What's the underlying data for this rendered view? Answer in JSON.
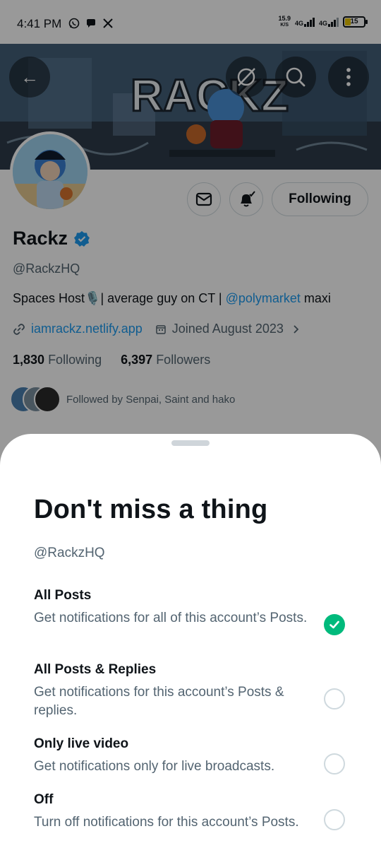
{
  "status_bar": {
    "time": "4:41 PM",
    "app_icons": [
      "whatsapp-icon",
      "chat-bubble-icon",
      "x-icon"
    ],
    "net_speed_value": "15.9",
    "net_speed_unit": "K/S",
    "signal_1": "4G",
    "signal_2": "4G",
    "battery": "15"
  },
  "header": {
    "back_icon": "←",
    "banner_text": "RACKZ"
  },
  "actions": {
    "following_label": "Following"
  },
  "profile": {
    "name": "Rackz",
    "handle": "@RackzHQ",
    "bio_prefix": "Spaces Host🎙️| average guy on CT | ",
    "bio_mention": "@polymarket",
    "bio_suffix": " maxi",
    "website": "iamrackz.netlify.app",
    "joined": "Joined August 2023",
    "following_count": "1,830",
    "following_label": "Following",
    "followers_count": "6,397",
    "followers_label": "Followers",
    "followed_by": "Followed by Senpai, Saint and hako"
  },
  "sheet": {
    "title": "Don't miss a thing",
    "handle": "@RackzHQ",
    "options": [
      {
        "title": "All Posts",
        "desc": "Get notifications for all of this account’s Posts.",
        "selected": true
      },
      {
        "title": "All Posts & Replies",
        "desc": "Get notifications for this account’s Posts & replies.",
        "selected": false
      },
      {
        "title": "Only live video",
        "desc": "Get notifications only for live broadcasts.",
        "selected": false
      },
      {
        "title": "Off",
        "desc": "Turn off notifications for this account’s Posts.",
        "selected": false
      }
    ]
  },
  "colors": {
    "accent_blue": "#1d9bf0",
    "selected_green": "#00ba7c",
    "muted_text": "#536471"
  }
}
